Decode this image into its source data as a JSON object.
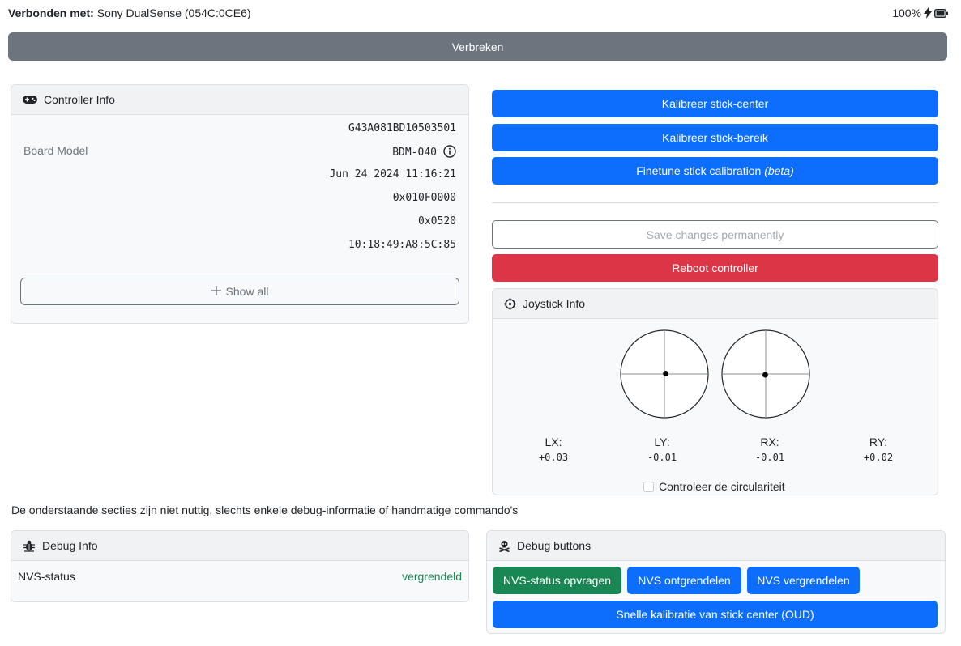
{
  "connection": {
    "label": "Verbonden met:",
    "device": "Sony DualSense (054C:0CE6)"
  },
  "battery": {
    "level_text": "100%",
    "charging_icon": "bolt-icon",
    "battery_icon": "battery-full-icon"
  },
  "disconnect_label": "Verbreken",
  "controller_info": {
    "title": "Controller Info",
    "icon": "gamepad-icon",
    "rows": [
      {
        "label": "",
        "value": "G43A081BD10503501"
      },
      {
        "label": "Board Model",
        "value": "BDM-040"
      },
      {
        "label": "",
        "value": "Jun 24 2024 11:16:21"
      },
      {
        "label": "",
        "value": "0x010F0000"
      },
      {
        "label": "",
        "value": "0x0520"
      },
      {
        "label": "",
        "value": "10:18:49:A8:5C:85"
      }
    ],
    "show_all_label": "Show all"
  },
  "actions": {
    "calibrate_center": "Kalibreer stick-center",
    "calibrate_range": "Kalibreer stick-bereik",
    "finetune_prefix": "Finetune stick calibration ",
    "finetune_suffix": "(beta)",
    "save_permanently": "Save changes permanently",
    "reboot": "Reboot controller"
  },
  "joystick_info": {
    "title": "Joystick Info",
    "icon": "crosshair-icon",
    "axes": [
      {
        "label": "LX:",
        "value": "+0.03"
      },
      {
        "label": "LY:",
        "value": "-0.01"
      },
      {
        "label": "RX:",
        "value": "-0.01"
      },
      {
        "label": "RY:",
        "value": "+0.02"
      }
    ],
    "circularity_label": "Controleer de circulariteit",
    "circularity_checked": false
  },
  "debug_note": "De onderstaande secties zijn niet nuttig, slechts enkele debug-informatie of handmatige commando's",
  "debug_info": {
    "title": "Debug Info",
    "icon": "bug-icon",
    "nvs_label": "NVS-status",
    "nvs_value": "vergrendeld"
  },
  "debug_buttons": {
    "title": "Debug buttons",
    "icon": "skull-crossbones-icon",
    "query_nvs": "NVS-status opvragen",
    "unlock_nvs": "NVS ontgrendelen",
    "lock_nvs": "NVS vergrendelen",
    "quick_center": "Snelle kalibratie van stick center (OUD)"
  },
  "colors": {
    "primary": "#0d6efd",
    "danger": "#dc3545",
    "success": "#198754",
    "secondary": "#6c757d"
  }
}
